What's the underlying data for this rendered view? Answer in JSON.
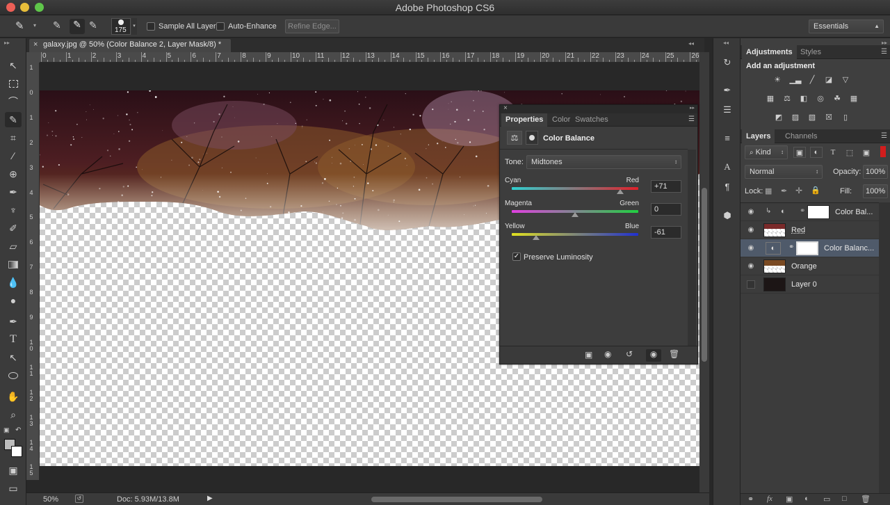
{
  "app": {
    "title": "Adobe Photoshop CS6"
  },
  "options": {
    "brush_size": "175",
    "sample_all_layers": "Sample All Layers",
    "auto_enhance": "Auto-Enhance",
    "refine_edge": "Refine Edge...",
    "workspace": "Essentials"
  },
  "document": {
    "tab_title": "galaxy.jpg @ 50% (Color Balance 2, Layer Mask/8) *",
    "zoom": "50%",
    "doc_size": "Doc: 5.93M/13.8M",
    "ruler_h": [
      "0",
      "1",
      "2",
      "3",
      "4",
      "5",
      "6",
      "7",
      "8",
      "9",
      "10",
      "11",
      "12",
      "13",
      "14",
      "15",
      "16",
      "17",
      "18",
      "19",
      "20",
      "21",
      "22",
      "23",
      "24",
      "25",
      "26"
    ],
    "ruler_v": [
      "1",
      "0",
      "1",
      "2",
      "3",
      "4",
      "5",
      "6",
      "7",
      "8",
      "9",
      "1 0",
      "1 1",
      "1 2",
      "1 3",
      "1 4",
      "1 5"
    ]
  },
  "properties": {
    "tabs": [
      "Properties",
      "Color",
      "Swatches"
    ],
    "title": "Color Balance",
    "tone_label": "Tone:",
    "tone_value": "Midtones",
    "sliders": [
      {
        "left": "Cyan",
        "right": "Red",
        "value": "+71"
      },
      {
        "left": "Magenta",
        "right": "Green",
        "value": "0"
      },
      {
        "left": "Yellow",
        "right": "Blue",
        "value": "-61"
      }
    ],
    "slider_levels": [
      0.855,
      0.5,
      0.195
    ],
    "preserve_luminosity": "Preserve Luminosity"
  },
  "adjustments": {
    "tabs": [
      "Adjustments",
      "Styles"
    ],
    "heading": "Add an adjustment"
  },
  "layers": {
    "tabs": [
      "Layers",
      "Channels"
    ],
    "kind": "Kind",
    "blend_mode": "Normal",
    "opacity_label": "Opacity:",
    "opacity": "100%",
    "lock_label": "Lock:",
    "fill_label": "Fill:",
    "fill": "100%",
    "rows": [
      {
        "name": "Color Bal..."
      },
      {
        "name": "Red"
      },
      {
        "name": "Color Balanc..."
      },
      {
        "name": "Orange"
      },
      {
        "name": "Layer 0"
      }
    ]
  }
}
